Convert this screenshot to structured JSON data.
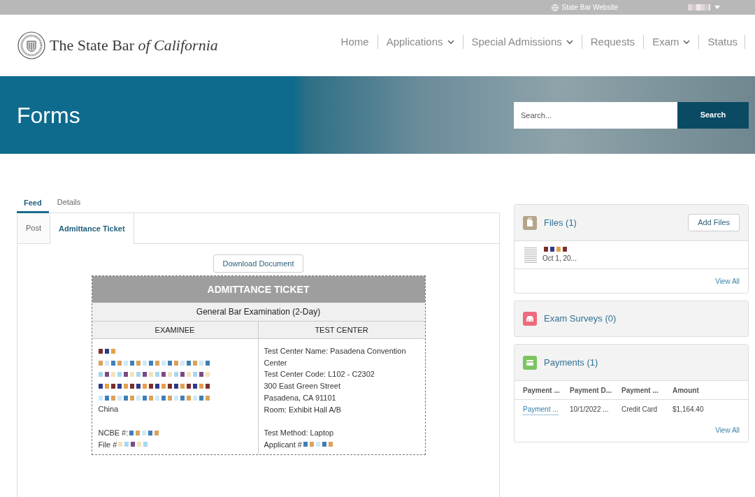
{
  "top_bar": {
    "link": "State Bar Website"
  },
  "logo": {
    "text_plain": "The State Bar",
    "text_italic": "of California"
  },
  "nav": [
    {
      "label": "Home",
      "dropdown": false
    },
    {
      "label": "Applications",
      "dropdown": true
    },
    {
      "label": "Special Admissions",
      "dropdown": true
    },
    {
      "label": "Requests",
      "dropdown": false
    },
    {
      "label": "Exam",
      "dropdown": true
    },
    {
      "label": "Status",
      "dropdown": false
    }
  ],
  "banner": {
    "title": "Forms",
    "search": {
      "placeholder": "Search...",
      "button": "Search"
    }
  },
  "tabs": [
    {
      "label": "Feed",
      "selected": true
    },
    {
      "label": "Details",
      "selected": false
    }
  ],
  "subtabs": [
    {
      "label": "Post",
      "selected": false
    },
    {
      "label": "Admittance Ticket",
      "selected": true
    }
  ],
  "download_button": "Download Document",
  "ticket": {
    "title": "ADMITTANCE TICKET",
    "exam": "General Bar Examination (2-Day)",
    "columns": [
      "EXAMINEE",
      "TEST CENTER"
    ],
    "examinee": [
      {
        "kind": "redacted"
      },
      {
        "kind": "redacted"
      },
      {
        "kind": "redacted"
      },
      {
        "kind": "redacted"
      },
      {
        "kind": "redacted"
      },
      {
        "kind": "text",
        "text": "China"
      },
      {
        "kind": "gap"
      },
      {
        "kind": "label",
        "text": "NCBE #:"
      },
      {
        "kind": "label",
        "text": "File #"
      }
    ],
    "test_center": [
      {
        "kind": "text",
        "text": "Test Center Name: Pasadena Convention Center"
      },
      {
        "kind": "text",
        "text": "Test Center Code: L102 - C2302"
      },
      {
        "kind": "text",
        "text": "300 East Green Street"
      },
      {
        "kind": "text",
        "text": "Pasadena,  CA  91101"
      },
      {
        "kind": "text",
        "text": "Room: Exhibit Hall A/B"
      },
      {
        "kind": "gap"
      },
      {
        "kind": "text",
        "text": "Test Method: Laptop"
      },
      {
        "kind": "label",
        "text": "Applicant #"
      }
    ]
  },
  "files": {
    "title": "Files (1)",
    "button": "Add Files",
    "items": [
      {
        "date": "Oct 1, 20..."
      }
    ],
    "view_all": "View All"
  },
  "exam_surveys": {
    "title": "Exam Surveys (0)"
  },
  "payments": {
    "title": "Payments (1)",
    "columns": [
      "Payment ...",
      "Payment D...",
      "Payment ...",
      "Amount"
    ],
    "rows": [
      [
        "Payment ...",
        "10/1/2022 ...",
        "Credit Card",
        "$1,164.40"
      ]
    ],
    "view_all": "View All"
  }
}
